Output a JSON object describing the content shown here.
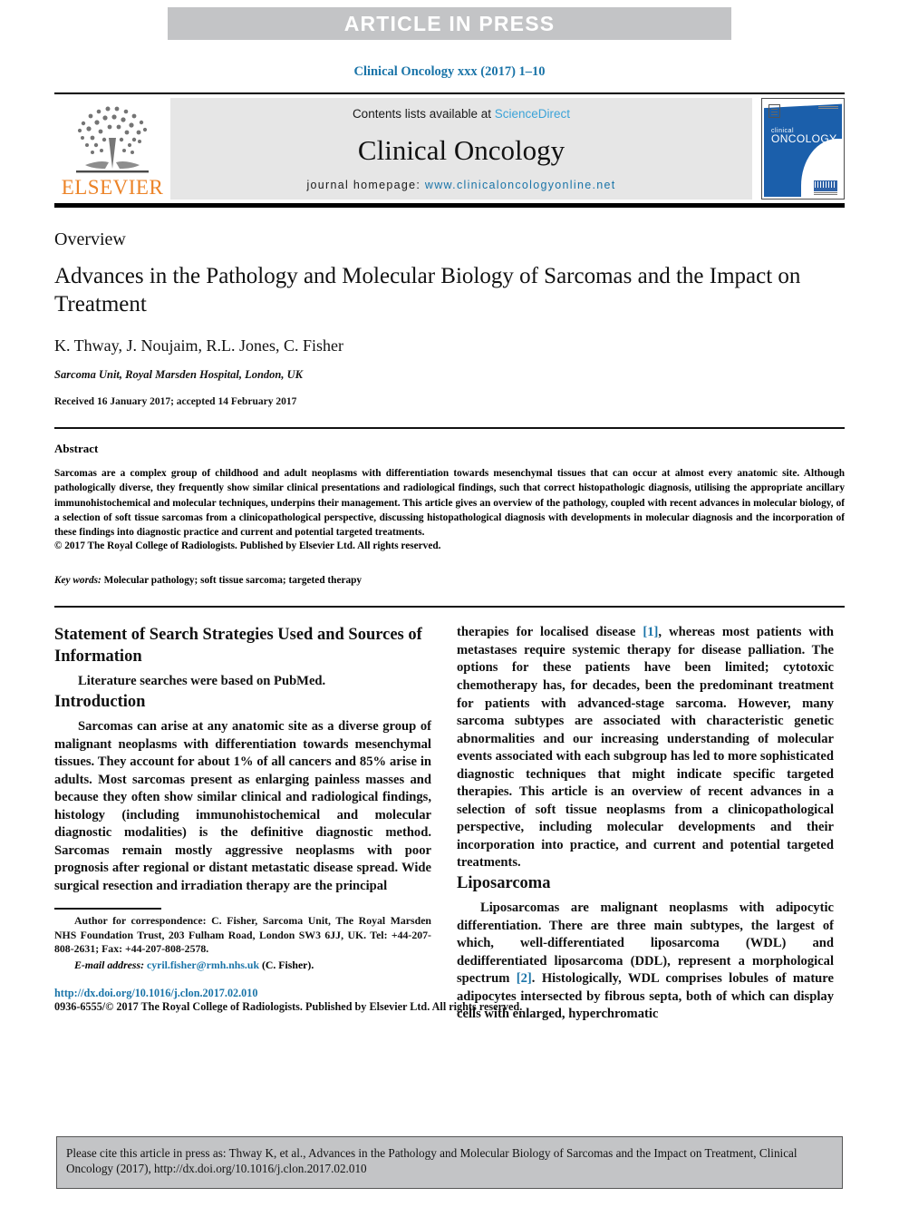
{
  "banner": {
    "label": "ARTICLE IN PRESS"
  },
  "running_head": "Clinical Oncology xxx (2017) 1–10",
  "masthead": {
    "publisher": "ELSEVIER",
    "contents_prefix": "Contents lists available at ",
    "contents_link": "ScienceDirect",
    "journal_name": "Clinical Oncology",
    "homepage_prefix": "journal homepage: ",
    "homepage_url": "www.clinicaloncologyonline.net",
    "cover_title_line1": "clinical",
    "cover_title_line2": "ONCOLOGY",
    "link_color": "#3ba3d8",
    "url_color": "#1a74a8",
    "elsevier_color": "#ec8327"
  },
  "article": {
    "kicker": "Overview",
    "title": "Advances in the Pathology and Molecular Biology of Sarcomas and the Impact on Treatment",
    "authors": "K. Thway, J. Noujaim, R.L. Jones, C. Fisher",
    "affiliation": "Sarcoma Unit, Royal Marsden Hospital, London, UK",
    "dates": "Received 16 January 2017; accepted 14 February 2017"
  },
  "abstract": {
    "heading": "Abstract",
    "body": "Sarcomas are a complex group of childhood and adult neoplasms with differentiation towards mesenchymal tissues that can occur at almost every anatomic site. Although pathologically diverse, they frequently show similar clinical presentations and radiological findings, such that correct histopathologic diagnosis, utilising the appropriate ancillary immunohistochemical and molecular techniques, underpins their management. This article gives an overview of the pathology, coupled with recent advances in molecular biology, of a selection of soft tissue sarcomas from a clinicopathological perspective, discussing histopathological diagnosis with developments in molecular diagnosis and the incorporation of these findings into diagnostic practice and current and potential targeted treatments.",
    "copyright": "© 2017 The Royal College of Radiologists. Published by Elsevier Ltd. All rights reserved.",
    "keywords_label": "Key words:",
    "keywords_value": " Molecular pathology; soft tissue sarcoma; targeted therapy"
  },
  "left_column": {
    "search_heading": "Statement of Search Strategies Used and Sources of Information",
    "search_para": "Literature searches were based on PubMed.",
    "intro_heading": "Introduction",
    "intro_para": "Sarcomas can arise at any anatomic site as a diverse group of malignant neoplasms with differentiation towards mesenchymal tissues. They account for about 1% of all cancers and 85% arise in adults. Most sarcomas present as enlarging painless masses and because they often show similar clinical and radiological findings, histology (including immunohistochemical and molecular diagnostic modalities) is the definitive diagnostic method. Sarcomas remain mostly aggressive neoplasms with poor prognosis after regional or distant metastatic disease spread. Wide surgical resection and irradiation therapy are the principal"
  },
  "footnote": {
    "correspondence": "Author for correspondence: C. Fisher, Sarcoma Unit, The Royal Marsden NHS Foundation Trust, 203 Fulham Road, London SW3 6JJ, UK. Tel: +44-207-808-2631; Fax: +44-207-808-2578.",
    "email_label": "E-mail address:",
    "email_value": "cyril.fisher@rmh.nhs.uk",
    "email_suffix": " (C. Fisher).",
    "doi": "http://dx.doi.org/10.1016/j.clon.2017.02.010",
    "issn_line": "0936-6555/© 2017 The Royal College of Radiologists. Published by Elsevier Ltd. All rights reserved."
  },
  "right_column": {
    "continuation_prefix": "therapies for localised disease ",
    "ref1": "[1]",
    "continuation_body": ", whereas most patients with metastases require systemic therapy for disease palliation. The options for these patients have been limited; cytotoxic chemotherapy has, for decades, been the predominant treatment for patients with advanced-stage sarcoma. However, many sarcoma subtypes are associated with characteristic genetic abnormalities and our increasing understanding of molecular events associated with each subgroup has led to more sophisticated diagnostic techniques that might indicate specific targeted therapies. This article is an overview of recent advances in a selection of soft tissue neoplasms from a clinicopathological perspective, including molecular developments and their incorporation into practice, and current and potential targeted treatments.",
    "liposarcoma_heading": "Liposarcoma",
    "lipo_part1": "Liposarcomas are malignant neoplasms with adipocytic differentiation. There are three main subtypes, the largest of which, well-differentiated liposarcoma (WDL) and dedifferentiated liposarcoma (DDL), represent a morphological spectrum ",
    "ref2": "[2]",
    "lipo_part2": ". Histologically, WDL comprises lobules of mature adipocytes intersected by fibrous septa, both of which can display cells with enlarged, hyperchromatic"
  },
  "citation_footer": {
    "text": "Please cite this article in press as: Thway K, et al., Advances in the Pathology and Molecular Biology of Sarcomas and the Impact on Treatment, Clinical Oncology (2017), http://dx.doi.org/10.1016/j.clon.2017.02.010"
  }
}
